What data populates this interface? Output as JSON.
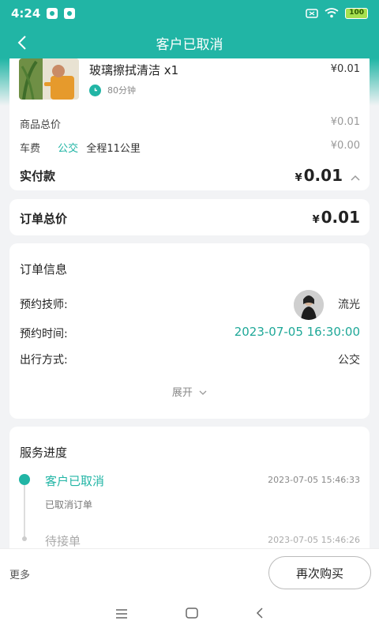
{
  "status_bar": {
    "time": "4:24",
    "battery": "100"
  },
  "nav": {
    "title": "客户已取消"
  },
  "product": {
    "name": "玻璃擦拭清洁 x1",
    "price": "¥0.01",
    "duration": "80分钟"
  },
  "fees": {
    "goods_total_label": "商品总价",
    "goods_total_value": "¥0.01",
    "fare_label": "车费",
    "fare_mode": "公交",
    "fare_distance": "全程11公里",
    "fare_value": "¥0.00",
    "paid_label": "实付款",
    "paid_yen": "¥",
    "paid_amount": "0.01"
  },
  "order_total": {
    "label": "订单总价",
    "yen": "¥",
    "amount": "0.01"
  },
  "order_info": {
    "title": "订单信息",
    "technician_label": "预约技师:",
    "technician_name": "流光",
    "time_label": "预约时间:",
    "time_value": "2023-07-05 16:30:00",
    "travel_label": "出行方式:",
    "travel_value": "公交",
    "expand_label": "展开"
  },
  "progress": {
    "title": "服务进度",
    "items": [
      {
        "status": "客户已取消",
        "time": "2023-07-05 15:46:33",
        "sub": "已取消订单"
      },
      {
        "status": "待接单",
        "time": "2023-07-05 15:46:26"
      }
    ]
  },
  "bottom": {
    "more_label": "更多",
    "rebuy_label": "再次购买"
  },
  "colors": {
    "accent": "#21b5a5"
  }
}
